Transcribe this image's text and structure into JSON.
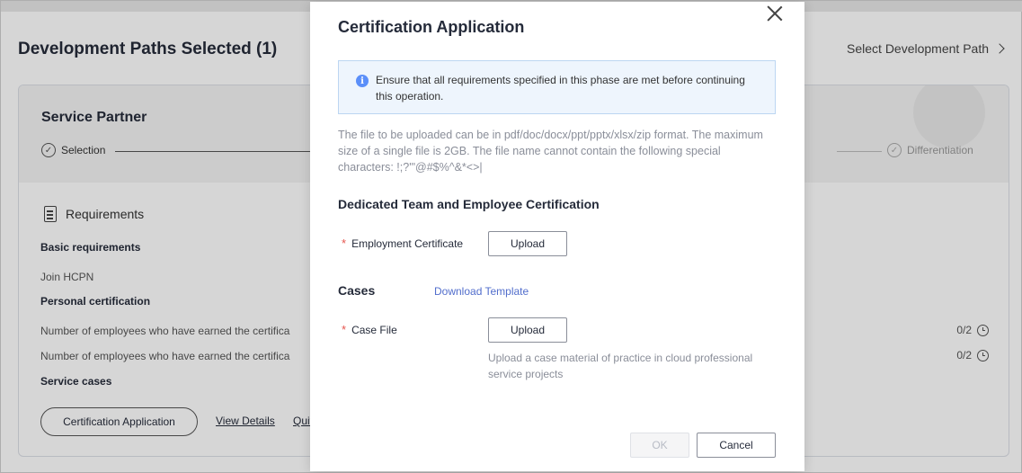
{
  "page": {
    "title": "Development Paths Selected (1)",
    "select_path_label": "Select Development Path",
    "card": {
      "title": "Service Partner",
      "steps": [
        {
          "label": "Selection"
        },
        {
          "label": "Differentiation"
        }
      ],
      "requirements_heading": "Requirements",
      "basic_heading": "Basic requirements",
      "basic_item": "Join HCPN",
      "personal_heading": "Personal certification",
      "personal_items": [
        {
          "text": "Number of employees who have earned the certifica",
          "count": "0/2"
        },
        {
          "text": "Number of employees who have earned the certifica",
          "count": "0/2"
        }
      ],
      "service_cases_heading": "Service cases",
      "cert_button": "Certification Application",
      "view_details": "View Details",
      "quit_partial": "Quit"
    }
  },
  "modal": {
    "title": "Certification Application",
    "alert_text": "Ensure that all requirements specified in this phase are met before continuing this operation.",
    "note": "The file to be uploaded can be in pdf/doc/docx/ppt/pptx/xlsx/zip format. The maximum size of a single file is 2GB. The file name cannot contain the following special characters: !;?'\"@#$%^&*<>|",
    "section1_title": "Dedicated Team and Employee Certification",
    "employment_label": "Employment Certificate",
    "upload_label": "Upload",
    "section2_title": "Cases",
    "download_template": "Download Template",
    "case_label": "Case File",
    "case_hint": "Upload a case material of practice in cloud professional service projects",
    "required_mark": "*",
    "ok_label": "OK",
    "cancel_label": "Cancel"
  },
  "colors": {
    "link": "#526ecc",
    "required": "#e5544d",
    "info": "#5b8ff9",
    "alert_bg": "#eef5fd"
  }
}
